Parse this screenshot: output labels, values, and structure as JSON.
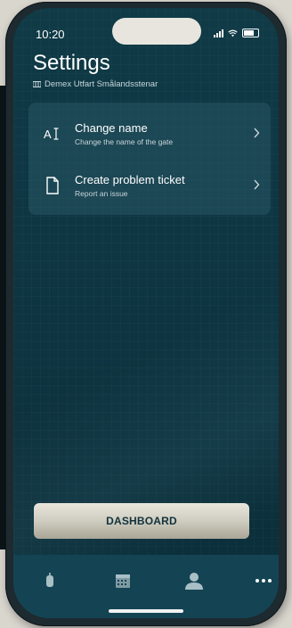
{
  "status_bar": {
    "time": "10:20"
  },
  "header": {
    "title": "Settings",
    "subtitle": "Demex Utfart Smålandsstenar"
  },
  "menu": {
    "items": [
      {
        "title": "Change name",
        "subtitle": "Change the name of the gate",
        "icon": "text-cursor-icon"
      },
      {
        "title": "Create problem ticket",
        "subtitle": "Report an issue",
        "icon": "document-icon"
      }
    ]
  },
  "actions": {
    "dashboard_label": "DASHBOARD"
  },
  "tabbar": {
    "tabs": [
      {
        "icon": "remote-icon"
      },
      {
        "icon": "calendar-icon"
      },
      {
        "icon": "person-icon"
      },
      {
        "icon": "more-icon"
      }
    ]
  },
  "colors": {
    "background": "#0d3440",
    "card": "#285564",
    "tabbar": "#144453",
    "button": "#cfccc0",
    "button_text": "#11323b"
  }
}
